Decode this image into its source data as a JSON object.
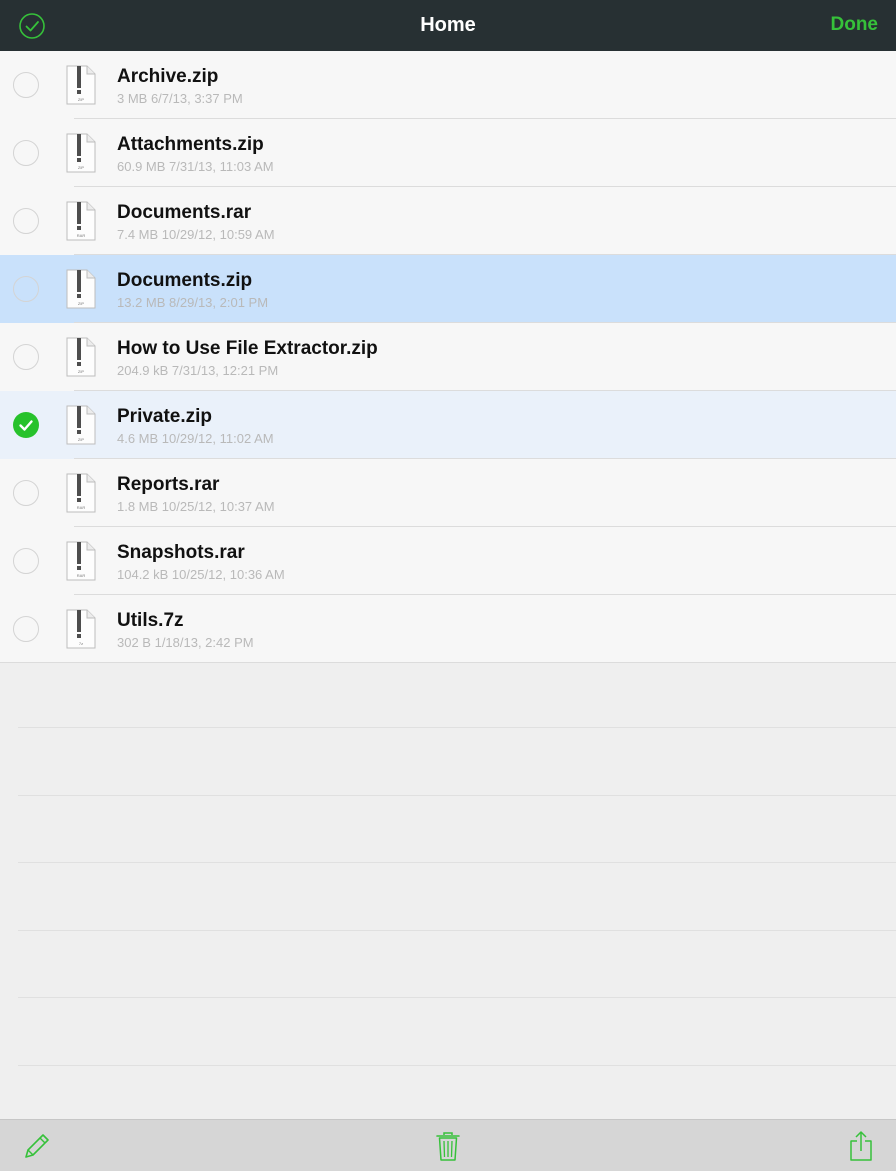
{
  "navbar": {
    "title": "Home",
    "done_label": "Done",
    "select_icon": "check-circle-icon"
  },
  "files": [
    {
      "name": "Archive.zip",
      "meta": "3 MB 6/7/13, 3:37 PM",
      "type_label": "ZIP",
      "state": "normal"
    },
    {
      "name": "Attachments.zip",
      "meta": "60.9 MB 7/31/13, 11:03 AM",
      "type_label": "ZIP",
      "state": "normal"
    },
    {
      "name": "Documents.rar",
      "meta": "7.4 MB 10/29/12, 10:59 AM",
      "type_label": "RAR",
      "state": "normal"
    },
    {
      "name": "Documents.zip",
      "meta": "13.2 MB 8/29/13, 2:01 PM",
      "type_label": "ZIP",
      "state": "highlight"
    },
    {
      "name": "How to Use File Extractor.zip",
      "meta": "204.9 kB 7/31/13, 12:21 PM",
      "type_label": "ZIP",
      "state": "normal"
    },
    {
      "name": "Private.zip",
      "meta": "4.6 MB 10/29/12, 11:02 AM",
      "type_label": "ZIP",
      "state": "checked"
    },
    {
      "name": "Reports.rar",
      "meta": "1.8 MB 10/25/12, 10:37 AM",
      "type_label": "RAR",
      "state": "normal"
    },
    {
      "name": "Snapshots.rar",
      "meta": "104.2 kB 10/25/12, 10:36 AM",
      "type_label": "RAR",
      "state": "normal"
    },
    {
      "name": "Utils.7z",
      "meta": "302 B 1/18/13, 2:42 PM",
      "type_label": "7z",
      "state": "normal"
    }
  ],
  "toolbar": {
    "rename_icon": "pencil-icon",
    "delete_icon": "trash-icon",
    "share_icon": "share-icon"
  },
  "colors": {
    "accent": "#36c13a",
    "navbar_bg": "#273033",
    "highlight_row": "#c9e1fb",
    "checked_row": "#eaf1fa",
    "toolbar_bg": "#d6d6d6"
  }
}
